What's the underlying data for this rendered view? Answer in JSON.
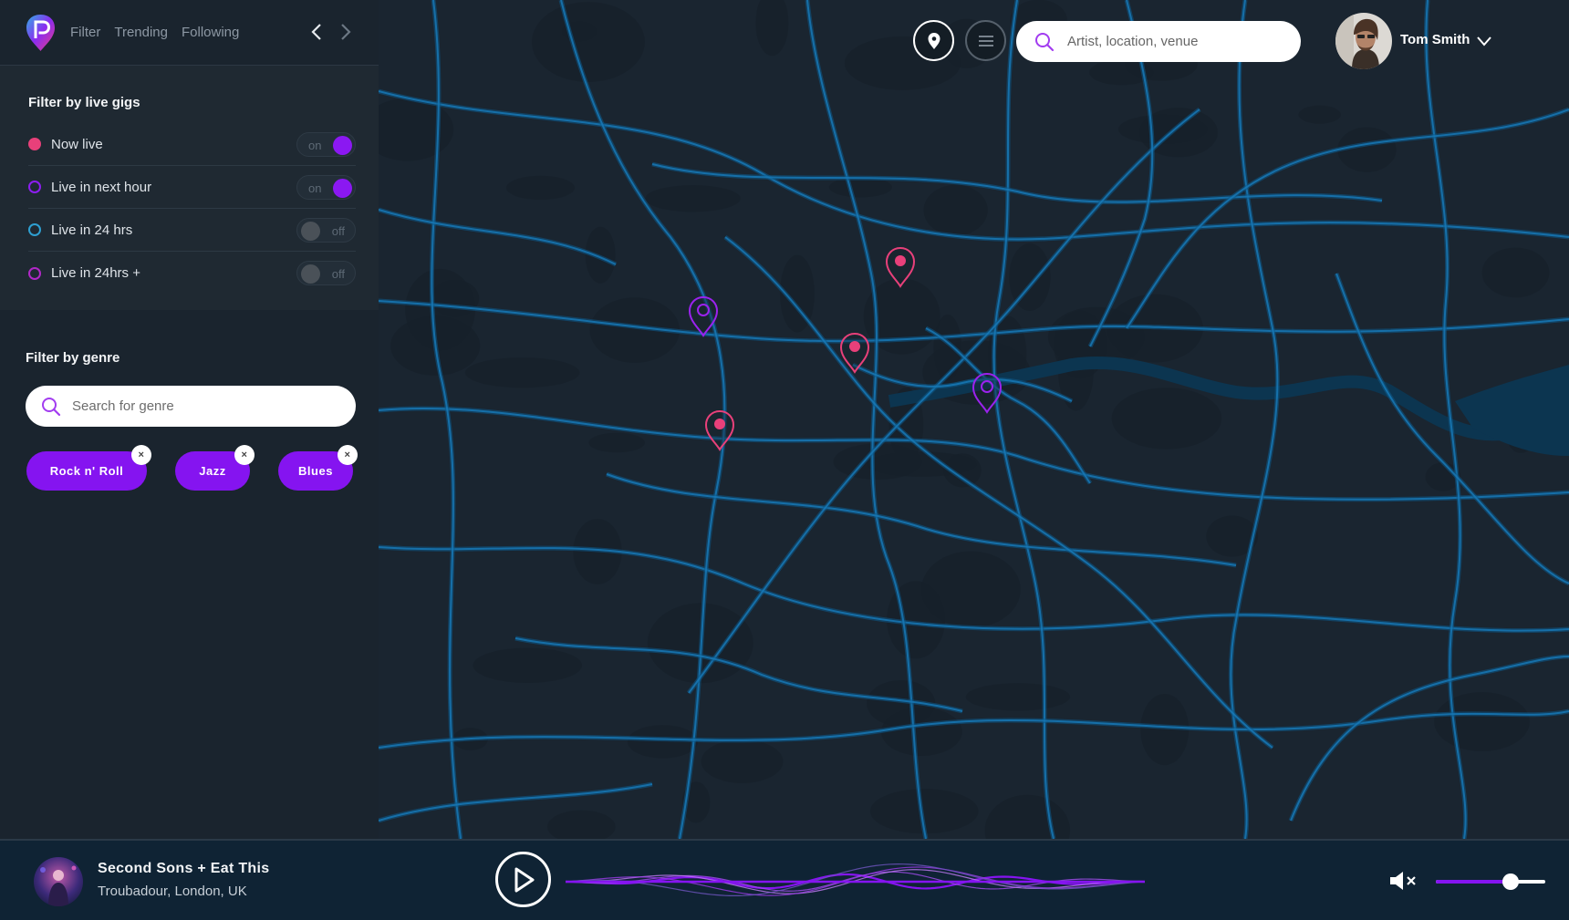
{
  "nav": {
    "links": [
      "Filter",
      "Trending",
      "Following"
    ]
  },
  "live_filter": {
    "title": "Filter by live gigs",
    "items": [
      {
        "label": "Now live",
        "dot": "solid",
        "color": "#e8407a",
        "state": "on"
      },
      {
        "label": "Live in next hour",
        "dot": "ring",
        "color": "#8c1ef0",
        "state": "on"
      },
      {
        "label": "Live in 24 hrs",
        "dot": "ring",
        "color": "#2e9fd1",
        "state": "off"
      },
      {
        "label": "Live in 24hrs +",
        "dot": "ring",
        "color": "#b128c8",
        "state": "off"
      }
    ]
  },
  "genre_filter": {
    "title": "Filter by genre",
    "search_placeholder": "Search for genre",
    "chips": [
      "Rock n' Roll",
      "Jazz",
      "Blues"
    ],
    "chip_remove": "×"
  },
  "top_bar": {
    "search_placeholder": "Artist, location, venue",
    "user_name": "Tom Smith"
  },
  "map": {
    "pins": [
      {
        "kind": "live",
        "color": "#e8407a"
      },
      {
        "kind": "upcoming",
        "color": "#9b22ee"
      },
      {
        "kind": "live",
        "color": "#e8407a"
      },
      {
        "kind": "upcoming",
        "color": "#9b22ee"
      },
      {
        "kind": "live",
        "color": "#e8407a"
      }
    ]
  },
  "player": {
    "track_title": "Second Sons + Eat This",
    "venue": "Troubadour, London, UK",
    "volume": 0.68
  },
  "colors": {
    "accent_purple": "#8514f0",
    "live_pink": "#e8407a",
    "road_blue": "#0d5a8a"
  }
}
